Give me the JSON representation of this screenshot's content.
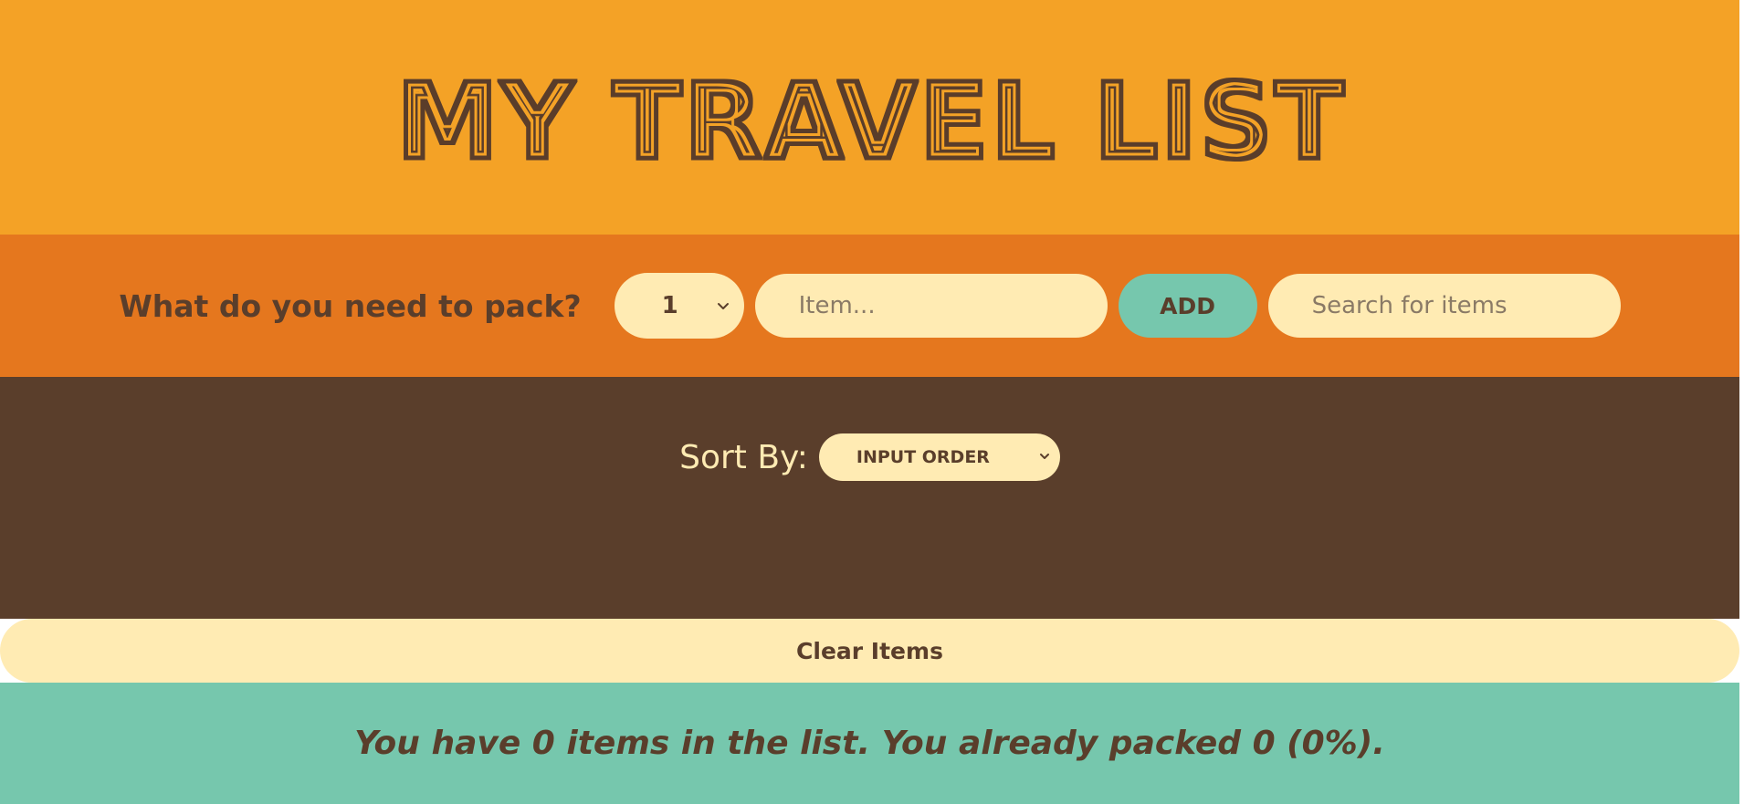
{
  "header": {
    "title": "MY TRAVEL LIST"
  },
  "form": {
    "prompt": "What do you need to pack?",
    "quantity_value": "1",
    "item_placeholder": "Item...",
    "add_label": "ADD",
    "search_placeholder": "Search for items"
  },
  "list": {
    "sort_label": "Sort By:",
    "sort_value": "INPUT ORDER"
  },
  "actions": {
    "clear_label": "Clear Items"
  },
  "stats": {
    "text": "You have 0 items in the list. You already packed 0 (0%)."
  },
  "colors": {
    "header_bg": "#f4a226",
    "form_bg": "#e5771e",
    "list_bg": "#5a3e2b",
    "cream": "#ffebb3",
    "teal": "#76c7ad",
    "brown": "#5a3e2b"
  },
  "icons": {
    "select_arrow": "chevron-down-icon"
  }
}
